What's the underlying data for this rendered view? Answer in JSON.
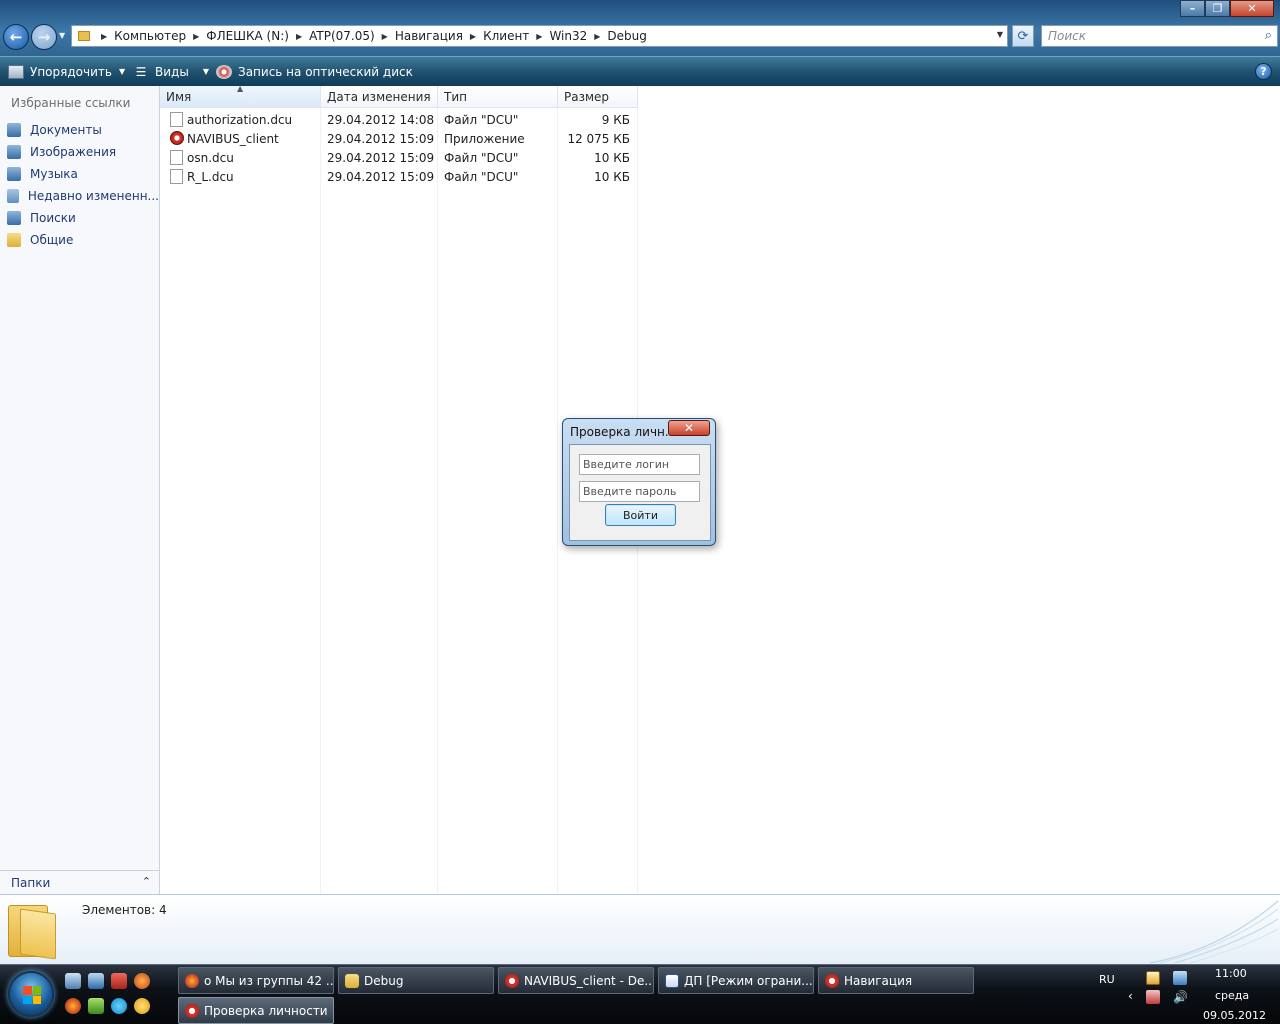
{
  "address_bar": {
    "breadcrumbs": [
      "Компьютер",
      "ФЛЕШКА (N:)",
      "ATP(07.05)",
      "Навигация",
      "Клиент",
      "Win32",
      "Debug"
    ],
    "search_placeholder": "Поиск"
  },
  "command_bar": {
    "organize": "Упорядочить",
    "views": "Виды",
    "burn": "Запись на оптический диск",
    "help": "?"
  },
  "nav_pane": {
    "favorites_title": "Избранные ссылки",
    "favorites": [
      {
        "label": "Документы",
        "icon": "documents-icon"
      },
      {
        "label": "Изображения",
        "icon": "pictures-icon"
      },
      {
        "label": "Музыка",
        "icon": "music-icon"
      },
      {
        "label": "Недавно измененн...",
        "icon": "recent-icon"
      },
      {
        "label": "Поиски",
        "icon": "searches-icon"
      },
      {
        "label": "Общие",
        "icon": "public-folder-icon"
      }
    ],
    "folders_label": "Папки"
  },
  "file_list": {
    "columns": [
      "Имя",
      "Дата изменения",
      "Тип",
      "Размер"
    ],
    "rows": [
      {
        "name": "authorization.dcu",
        "date": "29.04.2012 14:08",
        "type": "Файл \"DCU\"",
        "size": "9 КБ",
        "icon": "file-icon"
      },
      {
        "name": "NAVIBUS_client",
        "date": "29.04.2012 15:09",
        "type": "Приложение",
        "size": "12 075 КБ",
        "icon": "app-icon"
      },
      {
        "name": "osn.dcu",
        "date": "29.04.2012 15:09",
        "type": "Файл \"DCU\"",
        "size": "10 КБ",
        "icon": "file-icon"
      },
      {
        "name": "R_L.dcu",
        "date": "29.04.2012 15:09",
        "type": "Файл \"DCU\"",
        "size": "10 КБ",
        "icon": "file-icon"
      }
    ]
  },
  "details": {
    "item_count": "Элементов: 4"
  },
  "dialog": {
    "title": "Проверка личн...",
    "login_placeholder": "Введите логин",
    "password_placeholder": "Введите пароль",
    "login_button": "Войти"
  },
  "taskbar": {
    "tasks_row1": [
      "о Мы из группы 42 ...",
      "Debug",
      "NAVIBUS_client - De...",
      "ДП [Режим ограни...",
      "Навигация"
    ],
    "tasks_row2": [
      "Проверка личности"
    ],
    "language": "RU",
    "time": "11:00",
    "day": "среда",
    "date": "09.05.2012"
  },
  "colors": {
    "accent": "#1f4f7d",
    "link_text": "#1f3a73"
  }
}
